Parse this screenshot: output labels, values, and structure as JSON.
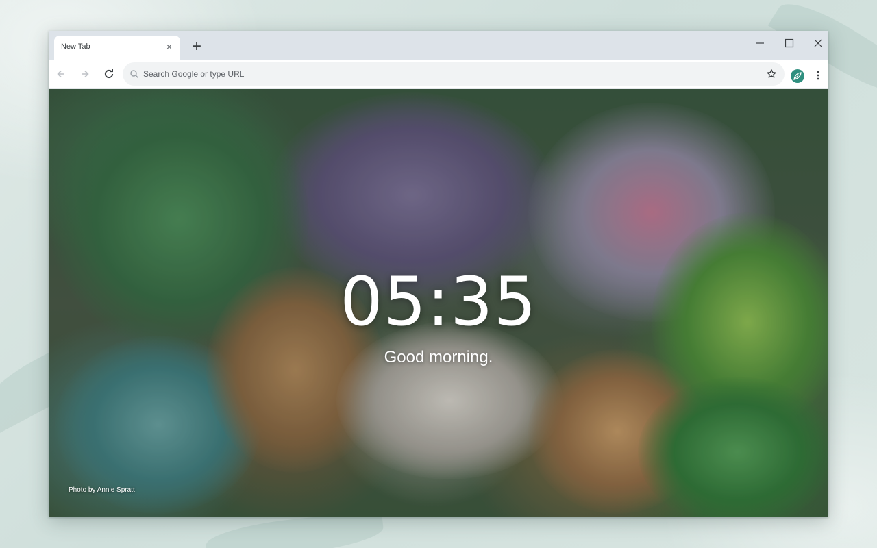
{
  "browser": {
    "tab": {
      "title": "New Tab",
      "close_glyph": "×"
    },
    "new_tab_glyph": "+",
    "window_controls": {
      "minimize": "minimize-icon",
      "maximize": "maximize-icon",
      "close": "close-icon"
    }
  },
  "toolbar": {
    "back_icon": "back-arrow-icon",
    "forward_icon": "forward-arrow-icon",
    "reload_icon": "reload-icon",
    "omnibox": {
      "placeholder": "Search Google or type URL",
      "value": ""
    },
    "bookmark_icon": "star-icon",
    "extension_icon": "leaf-extension-icon",
    "menu_icon": "more-vert-icon"
  },
  "newtab": {
    "time": "05:35",
    "greeting": "Good morning.",
    "photo_credit": "Photo by Annie Spratt"
  },
  "colors": {
    "tabstrip": "#dde3e9",
    "omnibox": "#f1f3f4",
    "accent_extension": "#2f8f7f"
  }
}
